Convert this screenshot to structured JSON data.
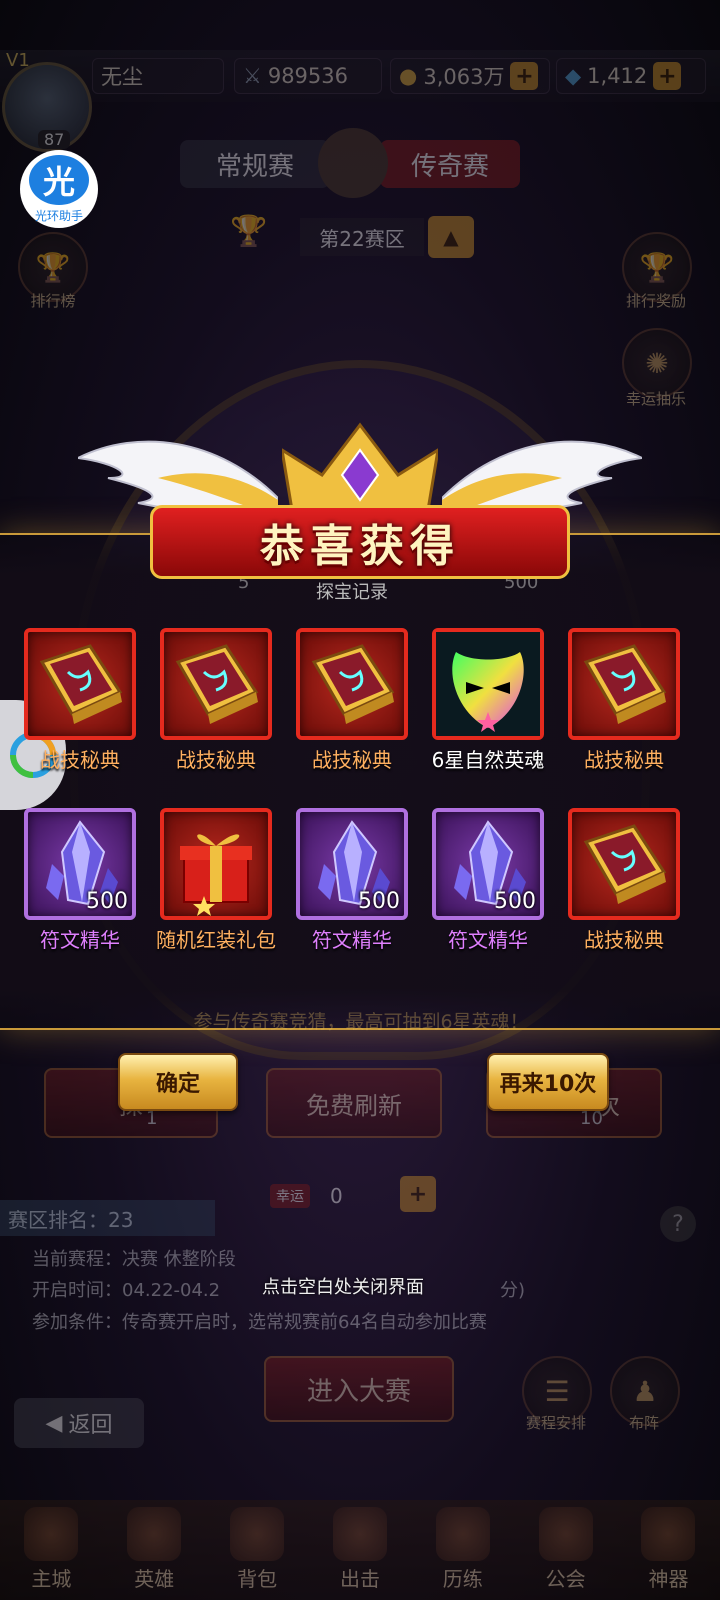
{
  "topbar": {
    "vip": "V1",
    "player_name": "无尘",
    "power": "989536",
    "gold": "3,063万",
    "gems": "1,412",
    "level": "87"
  },
  "helper": {
    "glyph": "光",
    "label": "光环助手"
  },
  "bg": {
    "tab_regular": "常规赛",
    "tab_legend": "传奇赛",
    "zone": "第22赛区",
    "rank_label": "排行榜",
    "rank_reward_label": "排行奖励",
    "lucky_label": "幸运抽乐",
    "panel_title": "幸运抽乐",
    "explore_btn": "探",
    "explore_cost": "1",
    "refresh_btn": "免费刷新",
    "ten_btn": "次",
    "ten_cost": "10",
    "ticket_tag": "幸运",
    "ticket_count": "0",
    "zone_rank": "赛区排名：23",
    "stage": "当前赛程：决赛 休整阶段",
    "open_time": "开启时间：04.22-04.2",
    "open_time_tail": "分)",
    "condition": "参加条件：传奇赛开启时，选常规赛前64名自动参加比赛",
    "enter_btn": "进入大赛",
    "back_btn": "返回",
    "schedule_label": "赛程安排",
    "formation_label": "布阵",
    "tip": "参与传奇赛竞猜，最高可抽到6星英魂！",
    "record": "探宝记录",
    "record_val": "500",
    "record_left": "5"
  },
  "nav": [
    "主城",
    "英雄",
    "背包",
    "出击",
    "历练",
    "公会",
    "神器"
  ],
  "reward": {
    "title": "恭喜获得",
    "items": [
      {
        "name": "战技秘典",
        "type": "book",
        "qty": ""
      },
      {
        "name": "战技秘典",
        "type": "book",
        "qty": ""
      },
      {
        "name": "战技秘典",
        "type": "book",
        "qty": ""
      },
      {
        "name": "6星自然英魂",
        "type": "soul",
        "qty": ""
      },
      {
        "name": "战技秘典",
        "type": "book",
        "qty": ""
      },
      {
        "name": "符文精华",
        "type": "crystal",
        "qty": "500"
      },
      {
        "name": "随机红装礼包",
        "type": "gift",
        "qty": ""
      },
      {
        "name": "符文精华",
        "type": "crystal",
        "qty": "500"
      },
      {
        "name": "符文精华",
        "type": "crystal",
        "qty": "500"
      },
      {
        "name": "战技秘典",
        "type": "book",
        "qty": ""
      }
    ],
    "confirm_btn": "确定",
    "again_btn": "再来10次",
    "close_hint": "点击空白处关闭界面"
  },
  "colors": {
    "red_frame": "#e52a1e",
    "purple_frame": "#b070e0",
    "gold": "#e8b440"
  }
}
